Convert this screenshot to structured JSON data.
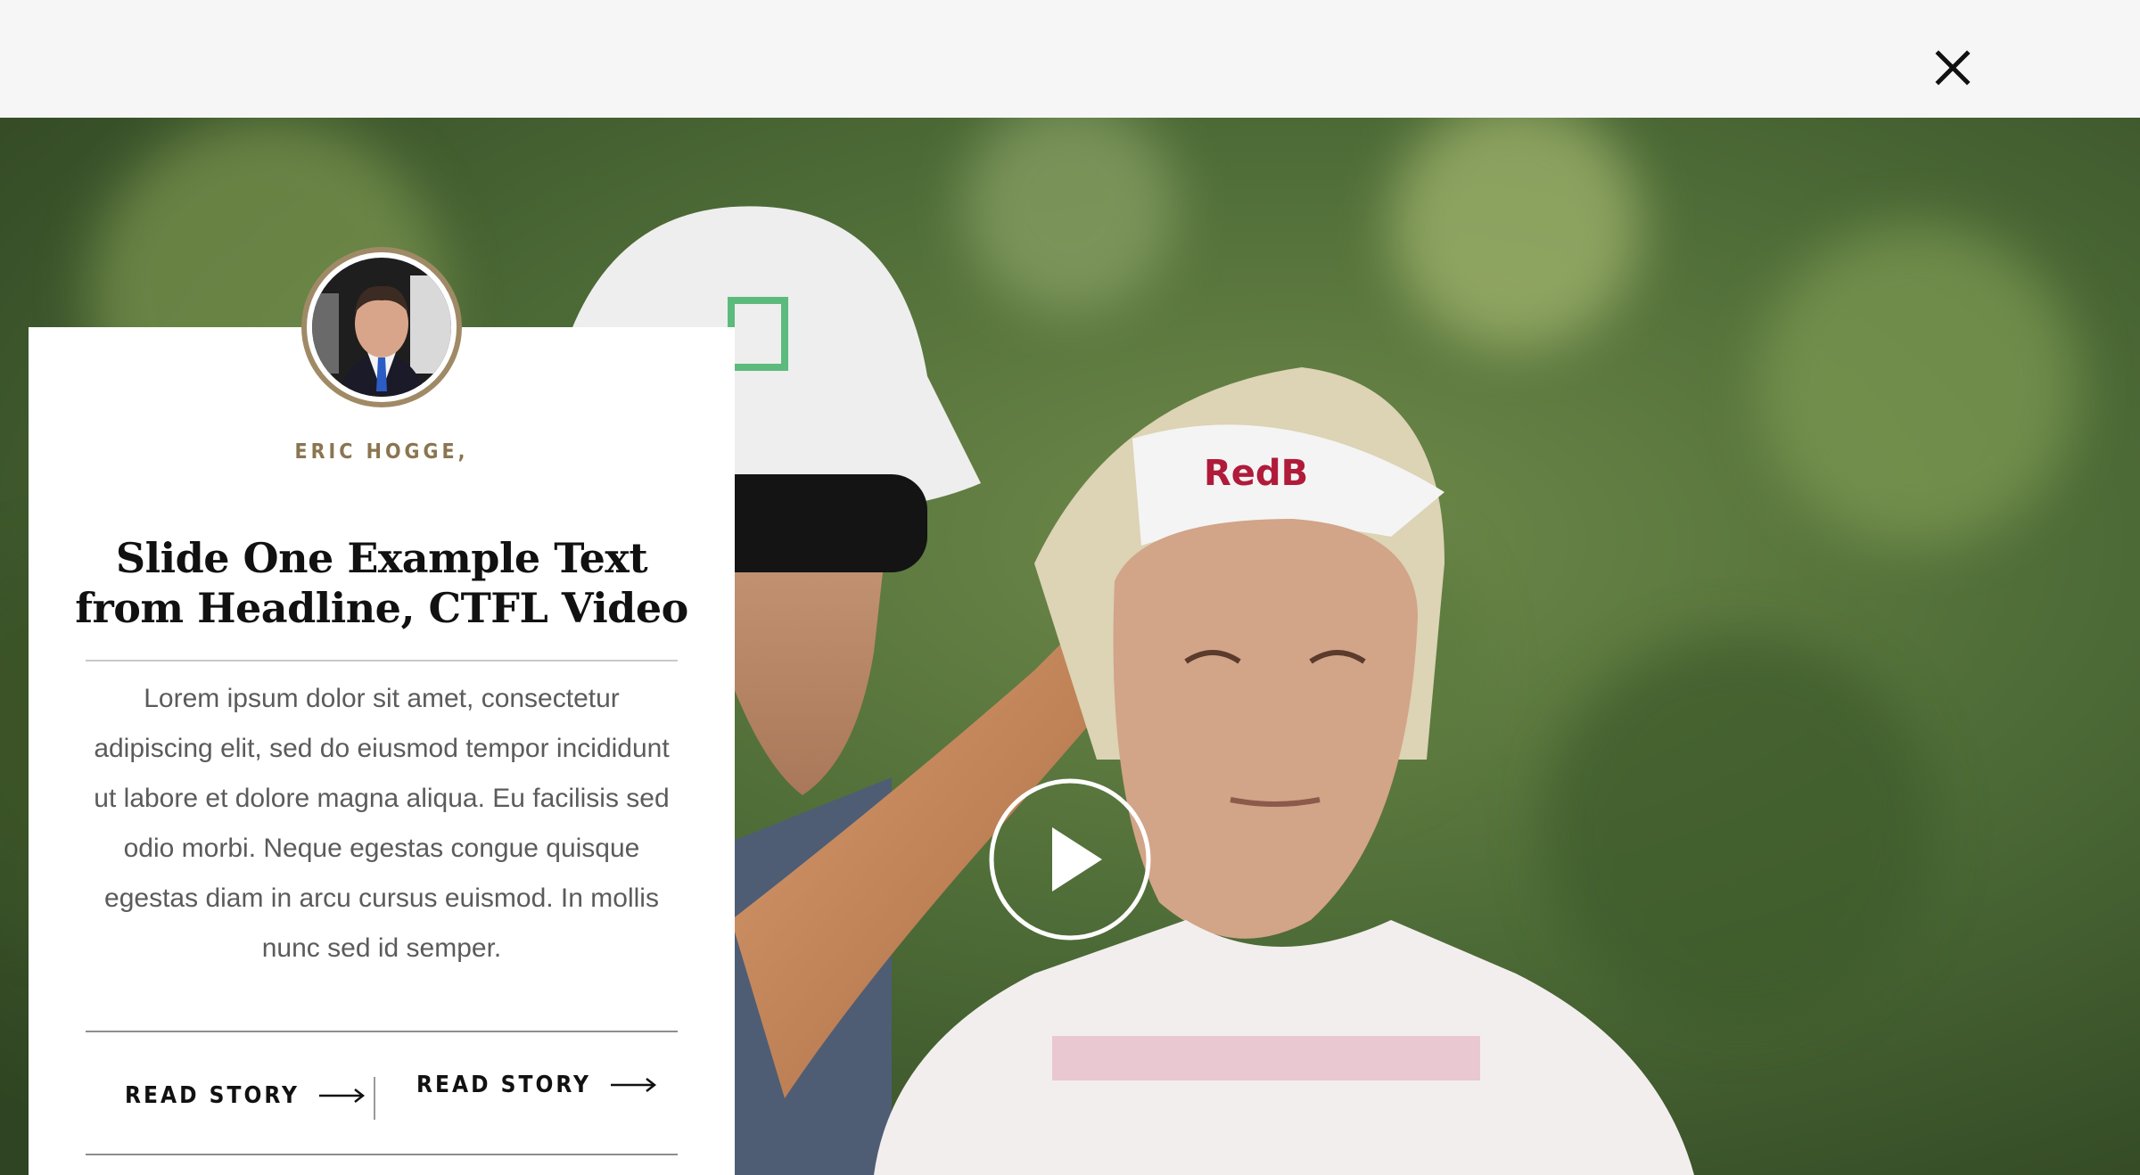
{
  "header": {
    "close_icon": "close-icon"
  },
  "hero": {
    "play_icon": "play-icon",
    "description": "video still"
  },
  "card": {
    "author": "ERIC HOGGE,",
    "headline": "Slide One Example Text from Headline, CTFL Video",
    "body": "Lorem ipsum dolor sit amet, consectetur adipiscing elit, sed do eiusmod tempor incididunt ut labore et dolore magna aliqua. Eu facilisis sed odio morbi. Neque egestas congue quisque egestas diam in arcu cursus euismod. In mollis nunc sed id semper.",
    "cta_left": "READ STORY",
    "cta_right": "READ STORY",
    "arrow_icon": "arrow-right-icon"
  },
  "colors": {
    "accent": "#8b7550",
    "card_bg": "#ffffff",
    "topbar_bg": "#f6f6f6"
  }
}
